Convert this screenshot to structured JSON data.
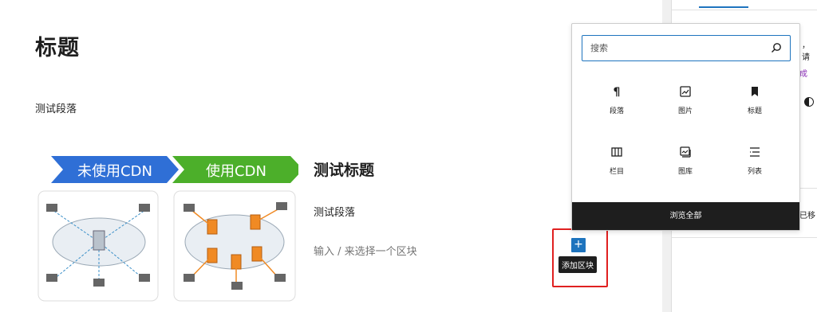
{
  "editor": {
    "post_title": "标题",
    "paragraph": "测试段落",
    "media_text": {
      "image_banner_left": "未使用CDN",
      "image_banner_right": "使用CDN",
      "heading": "测试标题",
      "paragraph": "测试段落",
      "placeholder": "输入 / 来选择一个区块"
    },
    "add_block_tooltip": "添加区块",
    "add_block_symbol": "+"
  },
  "inserter": {
    "search_placeholder": "搜索",
    "blocks": [
      {
        "label": "段落",
        "icon": "paragraph-icon"
      },
      {
        "label": "图片",
        "icon": "image-icon"
      },
      {
        "label": "标题",
        "icon": "heading-bookmark-icon"
      },
      {
        "label": "栏目",
        "icon": "columns-icon"
      },
      {
        "label": "图库",
        "icon": "gallery-icon"
      },
      {
        "label": "列表",
        "icon": "list-icon"
      }
    ],
    "browse_all": "浏览全部"
  },
  "sidebar": {
    "text_fragment_1": "，请",
    "text_fragment_2": "成",
    "text_fragment_3": "已移"
  },
  "colors": {
    "accent": "#1e74be",
    "highlight": "#e02020",
    "banner_blue": "#2f6fd6",
    "banner_green": "#4caf2a",
    "dark": "#1e1e1e"
  }
}
